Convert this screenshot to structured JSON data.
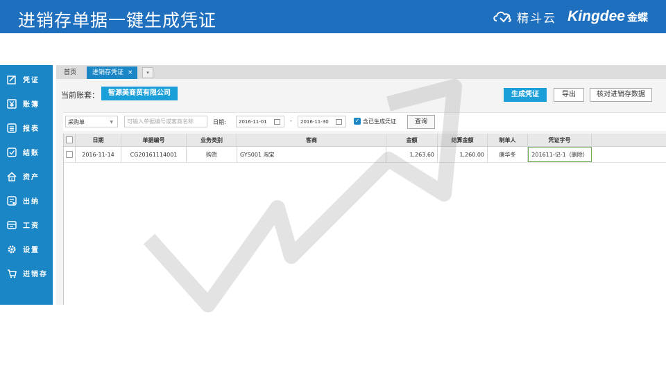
{
  "banner": {
    "title": "进销存单据一键生成凭证",
    "brand_cn": "精斗云",
    "brand_logo": "Kingdee",
    "brand_logo_cn": "金蝶"
  },
  "sidebar": {
    "items": [
      {
        "label": "凭证",
        "icon": "voucher-edit-icon"
      },
      {
        "label": "账簿",
        "icon": "yuan-ledger-icon"
      },
      {
        "label": "报表",
        "icon": "report-list-icon"
      },
      {
        "label": "结账",
        "icon": "checkout-icon"
      },
      {
        "label": "资产",
        "icon": "asset-house-icon"
      },
      {
        "label": "出纳",
        "icon": "cashier-icon"
      },
      {
        "label": "工资",
        "icon": "salary-icon"
      },
      {
        "label": "设置",
        "icon": "gear-icon"
      },
      {
        "label": "进销存",
        "icon": "inventory-cart-icon"
      }
    ]
  },
  "tabs": {
    "home": "首页",
    "active": "进销存凭证",
    "close": "×",
    "more": "▾"
  },
  "account": {
    "label": "当前账套：",
    "name": "智源美商贸有限公司"
  },
  "toolbar": {
    "generate": "生成凭证",
    "export": "导出",
    "check": "核对进销存数据"
  },
  "filter": {
    "doc_type": "采购单",
    "search_placeholder": "可输入单据编号或客商名称",
    "date_label": "日期:",
    "date_from": "2016-11-01",
    "date_to": "2016-11-30",
    "dash": "-",
    "include_label": "含已生成凭证",
    "include_checked": true,
    "query": "查询"
  },
  "table": {
    "headers": [
      "日期",
      "单据编号",
      "业务类别",
      "客商",
      "金额",
      "结算金额",
      "制单人",
      "凭证字号"
    ],
    "rows": [
      {
        "date": "2016-11-14",
        "doc_no": "CG20161114001",
        "category": "购货",
        "partner": "GYS001 淘宝",
        "amount": "1,263.60",
        "settled": "1,260.00",
        "maker": "唐华冬",
        "voucher": "201611-记-1（删除）"
      }
    ]
  },
  "colors": {
    "banner": "#1f6fbf",
    "sidebar": "#1a86c6",
    "accent": "#1a9fd9",
    "voucher_border": "#6aa84f"
  }
}
